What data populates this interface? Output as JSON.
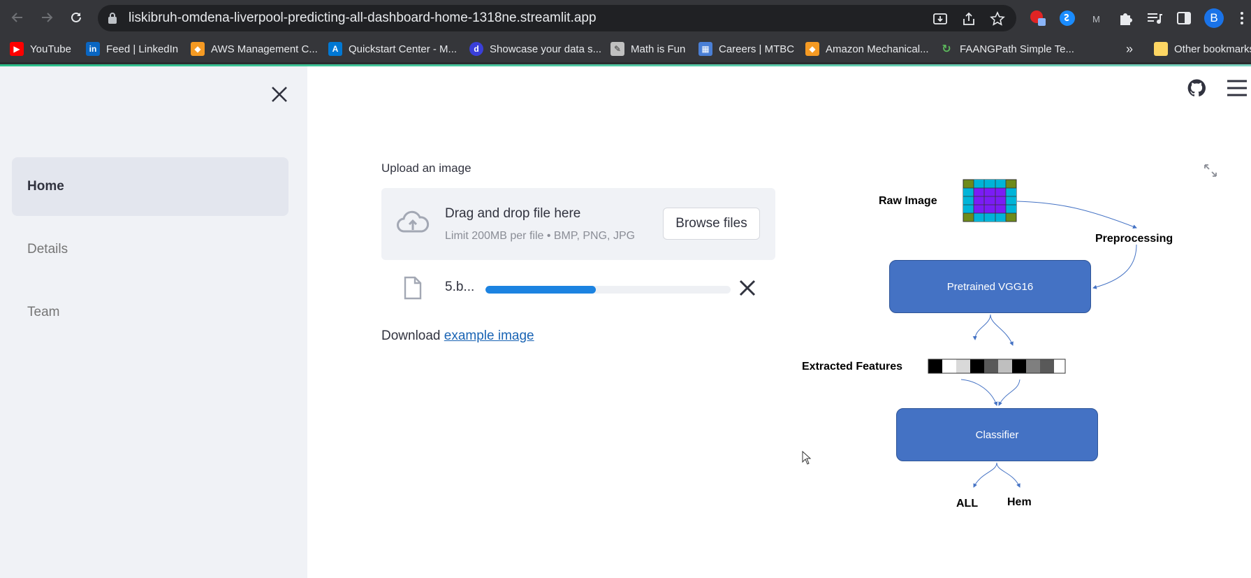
{
  "browser": {
    "url": "liskibruh-omdena-liverpool-predicting-all-dashboard-home-1318ne.streamlit.app",
    "profile_initial": "B",
    "bookmarks": [
      {
        "label": "YouTube",
        "icon": "youtube-icon",
        "color": "#ff0000"
      },
      {
        "label": "Feed | LinkedIn",
        "icon": "linkedin-icon",
        "color": "#0a66c2"
      },
      {
        "label": "AWS Management C...",
        "icon": "aws-icon",
        "color": "#f59a23"
      },
      {
        "label": "Quickstart Center - M...",
        "icon": "azure-icon",
        "color": "#0078d4"
      },
      {
        "label": "Showcase your data s...",
        "icon": "dataset-icon",
        "color": "#3a3fd9"
      },
      {
        "label": "Math is Fun",
        "icon": "mathisfun-icon",
        "color": "#c0c0c0"
      },
      {
        "label": "Careers | MTBC",
        "icon": "mtbc-icon",
        "color": "#4a7fd6"
      },
      {
        "label": "Amazon Mechanical...",
        "icon": "aws-icon",
        "color": "#f59a23"
      },
      {
        "label": "FAANGPath Simple Te...",
        "icon": "faangpath-icon",
        "color": "#5cb85c"
      }
    ],
    "more_bookmarks": "»",
    "other_bookmarks": "Other bookmarks"
  },
  "sidebar": {
    "items": [
      {
        "label": "Home",
        "active": true
      },
      {
        "label": "Details",
        "active": false
      },
      {
        "label": "Team",
        "active": false
      }
    ]
  },
  "uploader": {
    "label": "Upload an image",
    "drop_title": "Drag and drop file here",
    "drop_subtitle": "Limit 200MB per file • BMP, PNG, JPG",
    "browse_label": "Browse files",
    "file_name": "5.b...",
    "progress_percent": 45
  },
  "download": {
    "prefix": "Download ",
    "link_text": "example image"
  },
  "diagram": {
    "raw_image": "Raw Image",
    "preprocessing": "Preprocessing",
    "vgg": "Pretrained VGG16",
    "features": "Extracted Features",
    "classifier": "Classifier",
    "out_all": "ALL",
    "out_hem": "Hem",
    "box_color": "#4472c4"
  }
}
